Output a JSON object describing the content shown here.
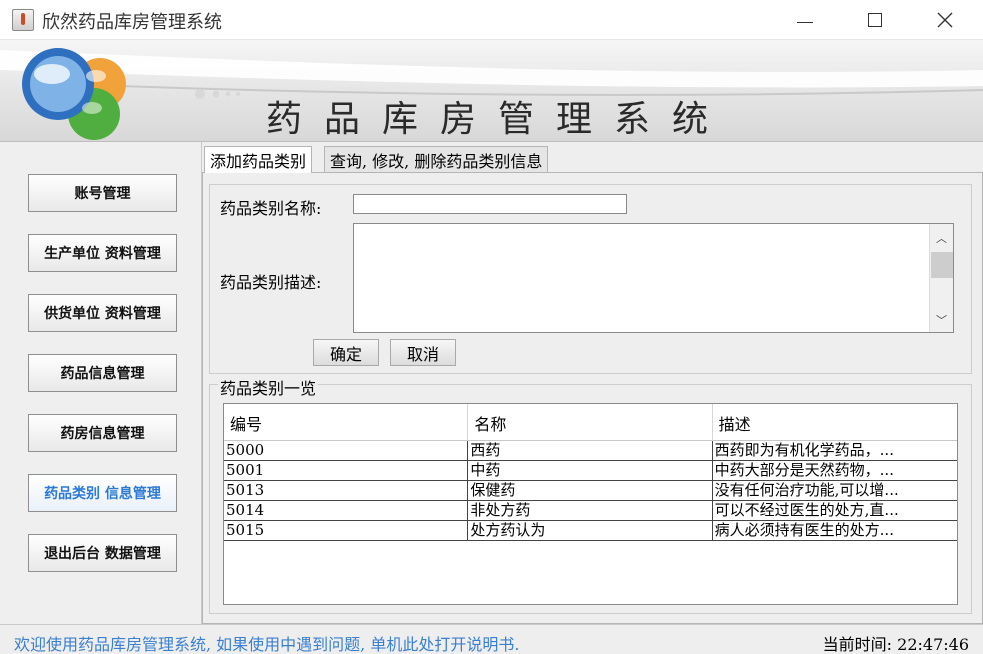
{
  "window": {
    "title": "欣然药品库房管理系统"
  },
  "banner": {
    "title": "药品库房管理系统"
  },
  "nav": {
    "items": [
      {
        "label": "账号管理",
        "active": false
      },
      {
        "label": "生产单位 资料管理",
        "active": false
      },
      {
        "label": "供货单位 资料管理",
        "active": false
      },
      {
        "label": "药品信息管理",
        "active": false
      },
      {
        "label": "药房信息管理",
        "active": false
      },
      {
        "label": "药品类别 信息管理",
        "active": true
      },
      {
        "label": "退出后台 数据管理",
        "active": false
      }
    ]
  },
  "tabs": {
    "add": "添加药品类别",
    "query": "查询, 修改, 删除药品类别信息"
  },
  "form": {
    "name_label": "药品类别名称:",
    "name_value": "",
    "desc_label": "药品类别描述:",
    "desc_value": "",
    "confirm": "确定",
    "cancel": "取消"
  },
  "list": {
    "legend": "药品类别一览",
    "headers": [
      "编号",
      "名称",
      "描述"
    ],
    "rows": [
      [
        "5000",
        "西药",
        "西药即为有机化学药品，..."
      ],
      [
        "5001",
        "中药",
        "中药大部分是天然药物，..."
      ],
      [
        "5013",
        "保健药",
        "没有任何治疗功能,可以增..."
      ],
      [
        "5014",
        "非处方药",
        "可以不经过医生的处方,直..."
      ],
      [
        "5015",
        "处方药认为",
        "病人必须持有医生的处方..."
      ]
    ]
  },
  "status": {
    "message": "欢迎使用药品库房管理系统, 如果使用中遇到问题, 单机此处打开说明书.",
    "time": "当前时间: 22:47:46"
  },
  "colors": {
    "active_nav": "#2c7ad6",
    "status_link": "#3a7fd0"
  }
}
